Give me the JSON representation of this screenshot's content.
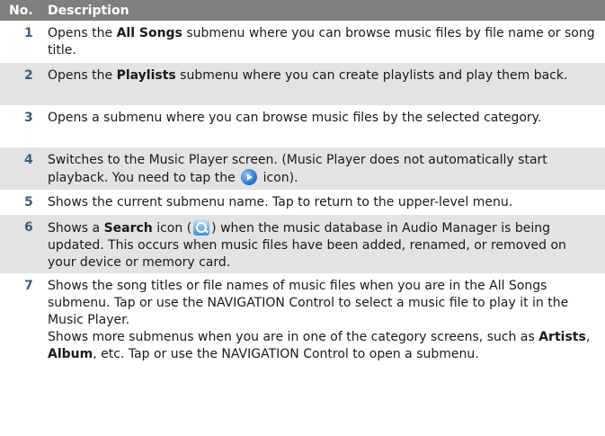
{
  "header": {
    "no": "No.",
    "description": "Description"
  },
  "rows": [
    {
      "no": "1",
      "p1": "Opens the ",
      "b1": "All Songs",
      "p2": " submenu where you can browse music files by file name or song title."
    },
    {
      "no": "2",
      "p1": "Opens the ",
      "b1": "Playlists",
      "p2": " submenu where you can create playlists and play them back."
    },
    {
      "no": "3",
      "text": "Opens a submenu where you can browse music files by the selected category."
    },
    {
      "no": "4",
      "p1": "Switches to the Music Player screen. (Music Player does not automatically start playback. You need to tap the ",
      "icon": "play-icon",
      "p2": " icon)."
    },
    {
      "no": "5",
      "text": "Shows the current submenu name. Tap to return to the upper-level menu."
    },
    {
      "no": "6",
      "p1": "Shows a ",
      "b1": "Search",
      "p2": " icon (",
      "icon": "search-icon",
      "p3": ") when the music database in Audio Manager is being updated. This occurs when music files have been added, renamed, or removed on your device or memory card."
    },
    {
      "no": "7",
      "para1": "Shows the song titles or file names of music files when you are in the All Songs submenu. Tap or use the NAVIGATION Control to select a music file to play it in the Music Player.",
      "p1": "Shows more submenus when you are in one of the category screens, such as ",
      "b1": "Artists",
      "p2": ", ",
      "b2": "Album",
      "p3": ", etc. Tap or use the NAVIGATION Control to open a submenu."
    }
  ]
}
